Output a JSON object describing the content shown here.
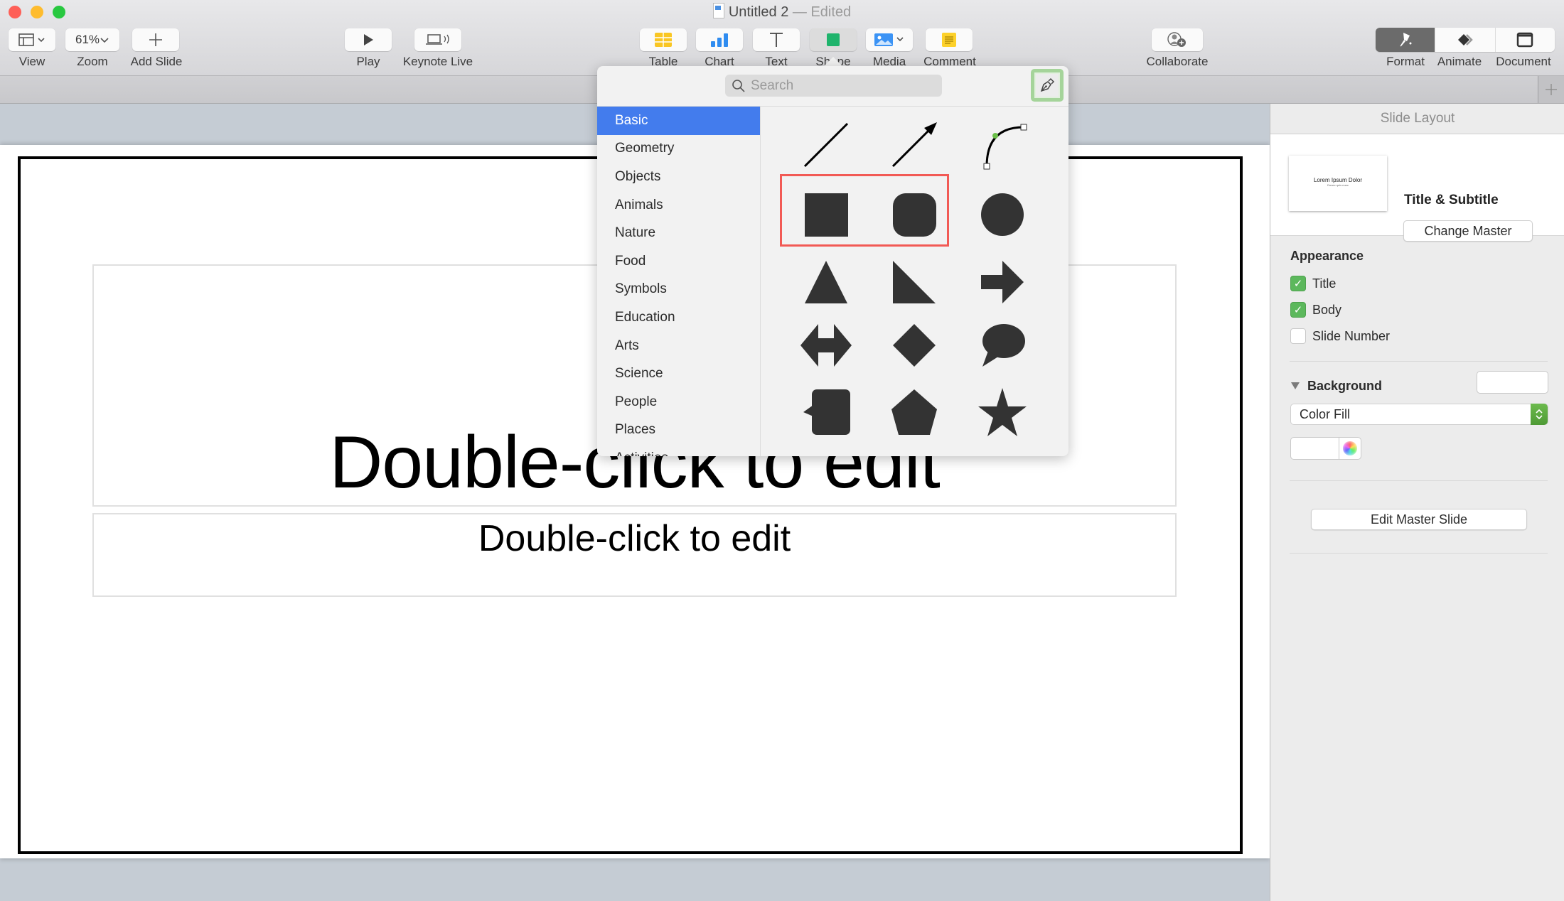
{
  "window": {
    "title": "Untitled 2",
    "status": "— Edited",
    "traffic_lights": {
      "close": "#fe5f57",
      "minimize": "#febc2e",
      "zoom": "#28c840"
    }
  },
  "toolbar": {
    "view_label": "View",
    "zoom_label": "Zoom",
    "zoom_value": "61%",
    "add_slide_label": "Add Slide",
    "play_label": "Play",
    "keynote_live_label": "Keynote Live",
    "table_label": "Table",
    "chart_label": "Chart",
    "text_label": "Text",
    "shape_label": "Shape",
    "media_label": "Media",
    "comment_label": "Comment",
    "collaborate_label": "Collaborate",
    "format_label": "Format",
    "animate_label": "Animate",
    "document_label": "Document",
    "active_inspector": "Format"
  },
  "tabstrip": {
    "add_icon": "plus-icon"
  },
  "slide": {
    "title_placeholder": "Double-click to edit",
    "subtitle_placeholder": "Double-click to edit"
  },
  "shape_popover": {
    "search_placeholder": "Search",
    "draw_with_pen_icon": "pen-icon",
    "categories": [
      "Basic",
      "Geometry",
      "Objects",
      "Animals",
      "Nature",
      "Food",
      "Symbols",
      "Education",
      "Arts",
      "Science",
      "People",
      "Places",
      "Activities"
    ],
    "selected_category": "Basic",
    "shapes": [
      "line",
      "arrow",
      "curve",
      "square",
      "rounded-square",
      "circle",
      "triangle",
      "right-triangle",
      "arrow-right",
      "double-arrow",
      "diamond",
      "speech-bubble",
      "callout",
      "pentagon",
      "star"
    ],
    "highlighted_shapes": [
      "square",
      "rounded-square"
    ],
    "highlight_color": "#f25a55",
    "selected_color": "#437ced"
  },
  "sidebar": {
    "header": "Slide Layout",
    "layout_name": "Title & Subtitle",
    "thumbnail_title": "Lorem Ipsum Dolor",
    "thumbnail_subtitle": "Donec quis nunc",
    "change_master_label": "Change Master",
    "appearance_title": "Appearance",
    "checkboxes": [
      {
        "label": "Title",
        "checked": true
      },
      {
        "label": "Body",
        "checked": true
      },
      {
        "label": "Slide Number",
        "checked": false
      }
    ],
    "background_title": "Background",
    "fill_type": "Color Fill",
    "fill_color": "#ffffff",
    "edit_master_label": "Edit Master Slide",
    "accent_color": "#5cb85c"
  }
}
